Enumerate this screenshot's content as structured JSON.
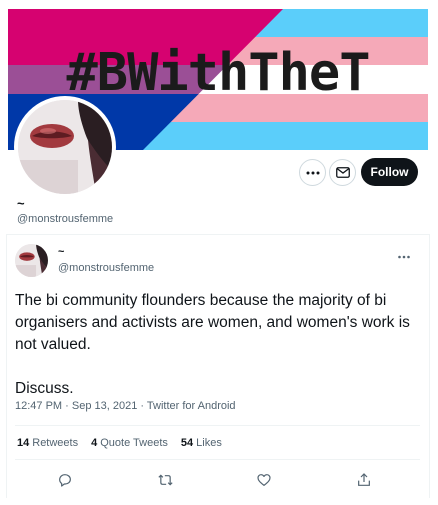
{
  "banner": {
    "hashtag_text": "#BWithTheT",
    "colors": {
      "bi_pink": "#D60270",
      "bi_purple": "#9B4F96",
      "bi_blue": "#0038A8",
      "trans_blue": "#5BCEFA",
      "trans_pink": "#F5A9B8",
      "trans_white": "#FFFFFF"
    }
  },
  "profile": {
    "display_name": "~",
    "handle": "@monstrousfemme",
    "follow_label": "Follow",
    "more_icon": "ellipsis-icon",
    "message_icon": "envelope-icon"
  },
  "tweet": {
    "display_name": "~",
    "handle": "@monstrousfemme",
    "text": "The bi community flounders because the majority of bi organisers and activists are women, and women's work is not valued.\n\nDiscuss.",
    "meta": "12:47 PM · Sep 13, 2021 · Twitter for Android",
    "stats": {
      "retweets_count": "14",
      "retweets_label": "Retweets",
      "quotes_count": "4",
      "quotes_label": "Quote Tweets",
      "likes_count": "54",
      "likes_label": "Likes"
    },
    "actions": [
      "reply-icon",
      "retweet-icon",
      "like-icon",
      "share-icon"
    ]
  },
  "theme": {
    "text_primary": "#0f1419",
    "text_secondary": "#536471",
    "border": "#eff3f4",
    "button_dark": "#0f1419"
  }
}
